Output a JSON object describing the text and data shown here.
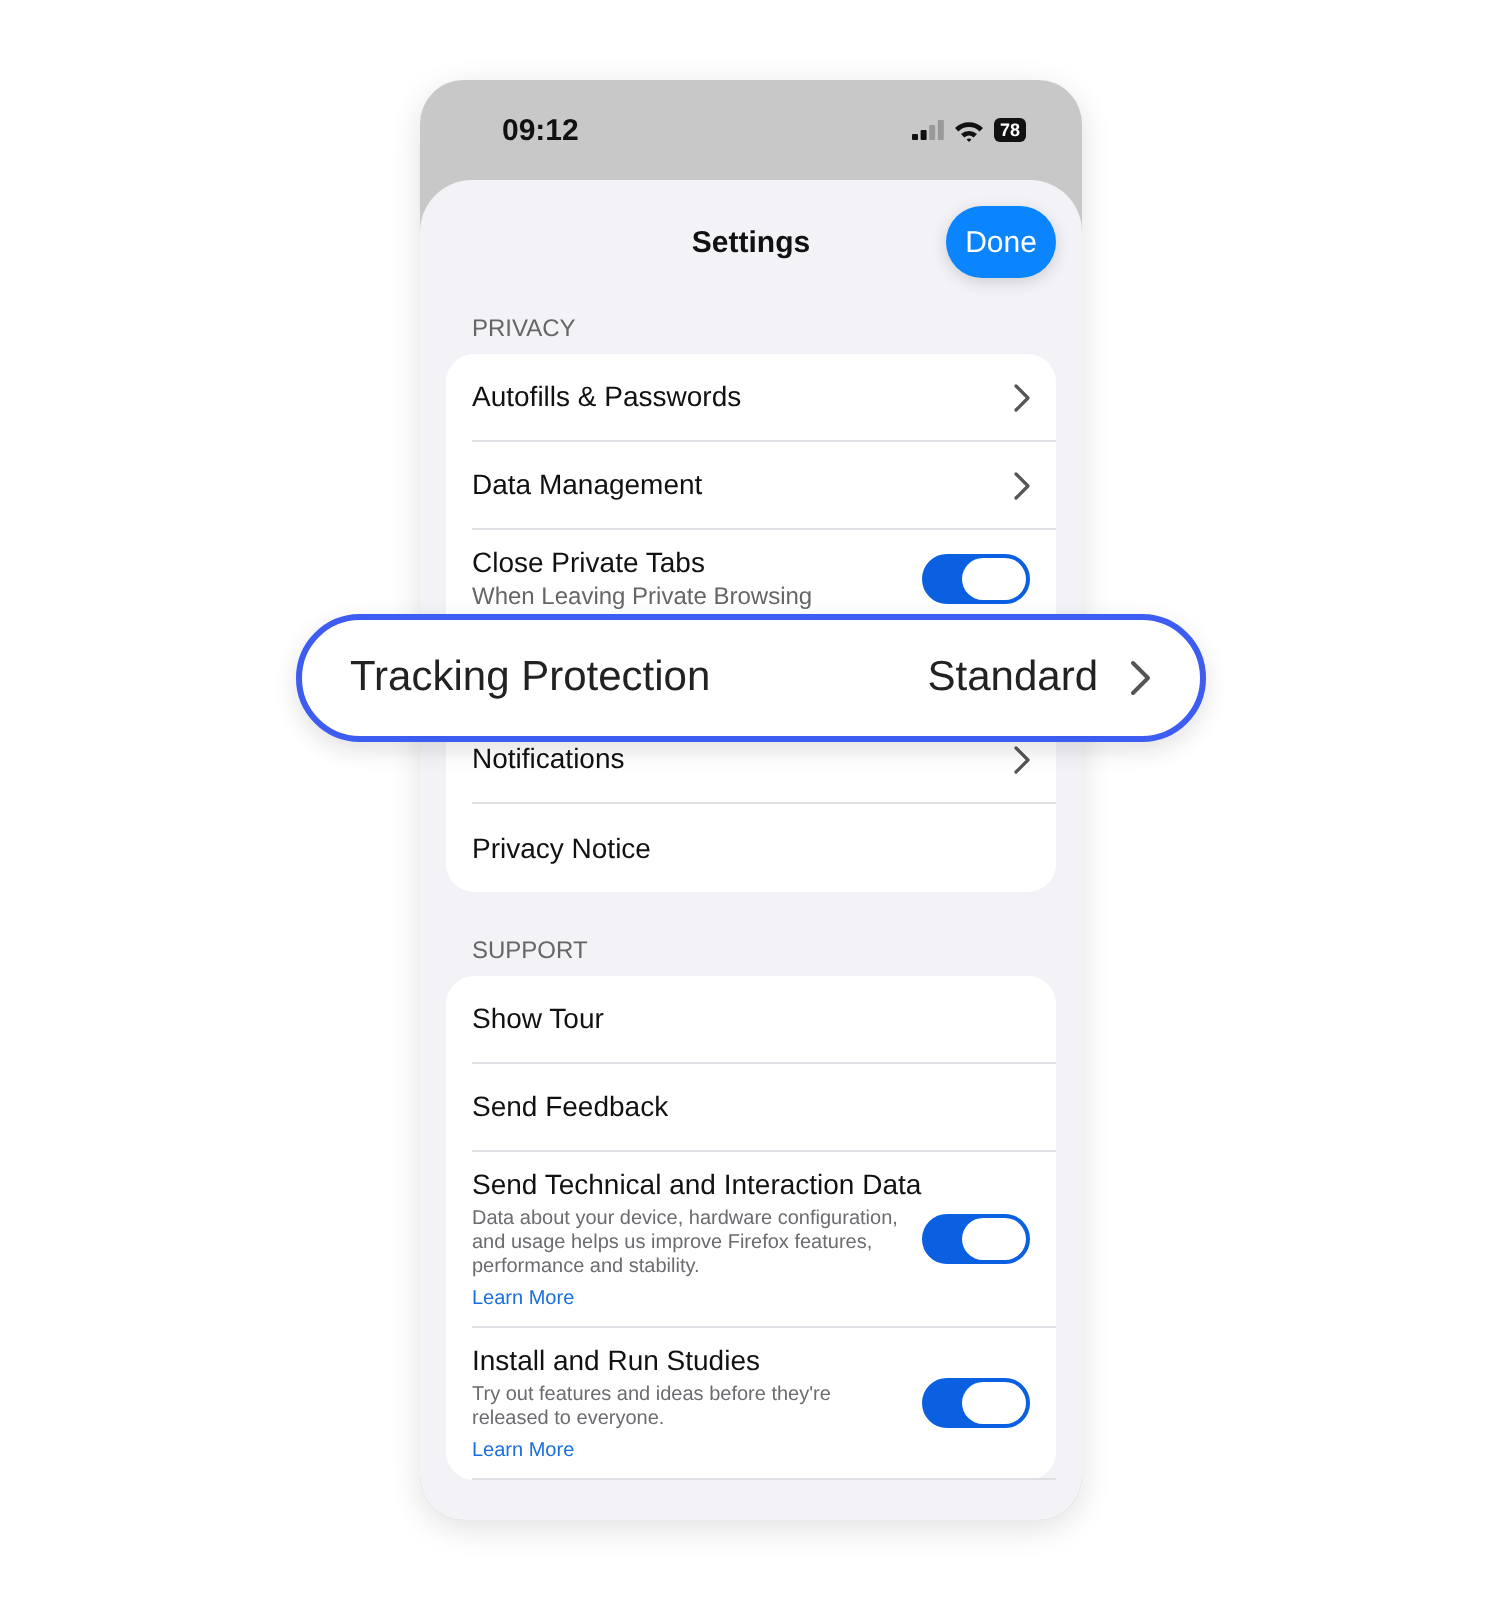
{
  "status_bar": {
    "time": "09:12",
    "battery": "78"
  },
  "header": {
    "title": "Settings",
    "done_button": "Done"
  },
  "sections": [
    {
      "title": "PRIVACY",
      "items": [
        {
          "kind": "link",
          "label": "Autofills & Passwords"
        },
        {
          "kind": "link",
          "label": "Data Management"
        },
        {
          "kind": "toggle",
          "label": "Close Private Tabs",
          "subtitle": "When Leaving Private Browsing",
          "on": true
        },
        {
          "kind": "hidden"
        },
        {
          "kind": "link",
          "label": "Notifications"
        },
        {
          "kind": "plain",
          "label": "Privacy Notice"
        }
      ]
    },
    {
      "title": "SUPPORT",
      "items": [
        {
          "kind": "plain",
          "label": "Show Tour"
        },
        {
          "kind": "plain",
          "label": "Send Feedback"
        },
        {
          "kind": "toggle",
          "label": "Send Technical and Interaction Data",
          "description": "Data about your device, hardware configuration, and usage helps us improve Firefox features, performance and stability.",
          "link": "Learn More",
          "on": true
        },
        {
          "kind": "toggle",
          "label": "Install and Run Studies",
          "description": "Try out features and ideas before they're released to everyone.",
          "link": "Learn More",
          "on": true
        }
      ]
    }
  ],
  "highlight": {
    "label": "Tracking Protection",
    "value": "Standard"
  }
}
